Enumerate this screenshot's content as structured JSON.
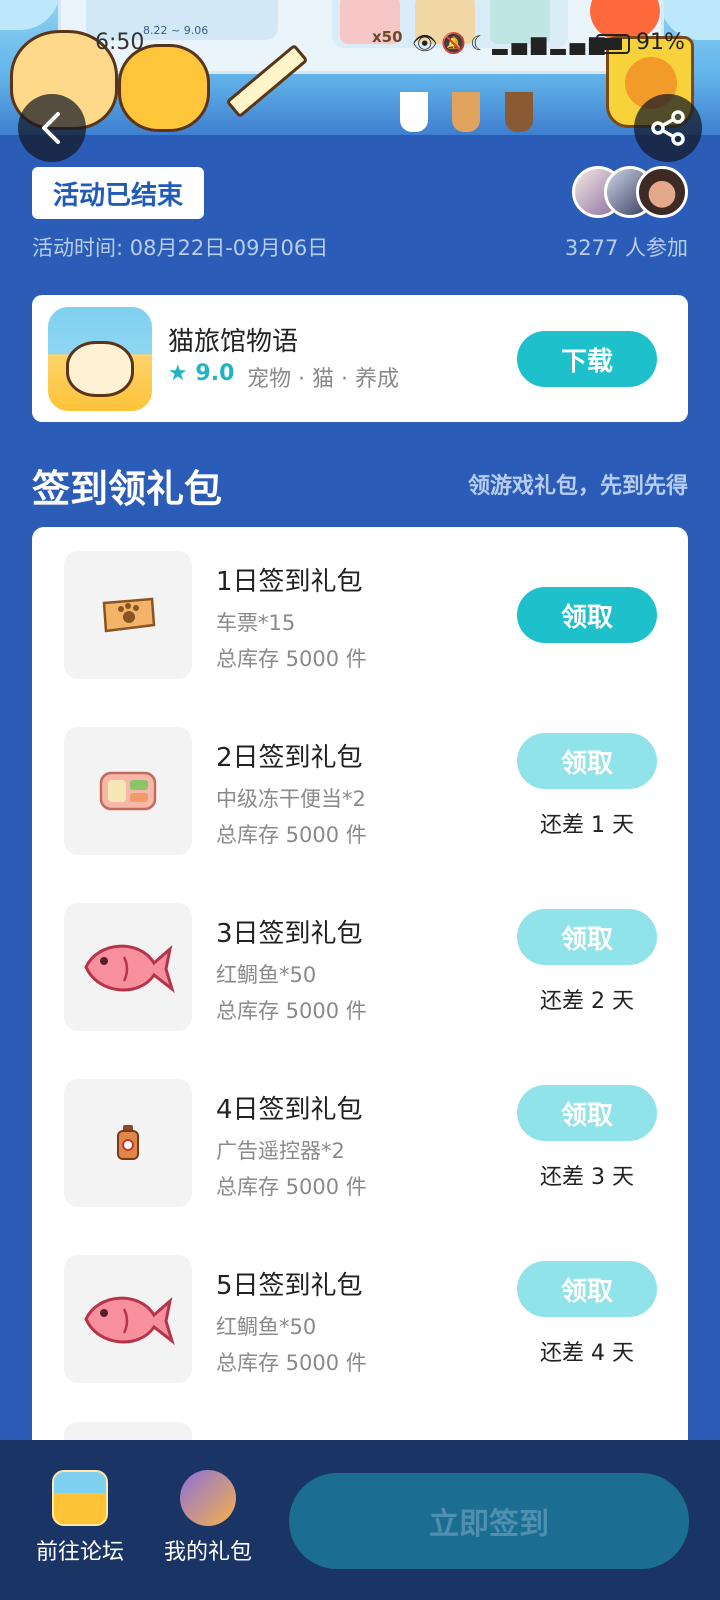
{
  "status_bar": {
    "time": "6:50",
    "battery": "91%"
  },
  "banner": {
    "date_range": "8.22 ~ 9.06",
    "reward_count": "x50"
  },
  "activity": {
    "status_badge": "活动已结束",
    "time": "活动时间: 08月22日-09月06日",
    "participants": "3277 人参加"
  },
  "app": {
    "name": "猫旅馆物语",
    "rating": "9.0",
    "tags": "宠物 · 猫 · 养成",
    "download_label": "下载"
  },
  "section": {
    "title": "签到领礼包",
    "subtitle": "领游戏礼包，先到先得"
  },
  "gifts": [
    {
      "name": "1日签到礼包",
      "item": "车票*15",
      "stock": "总库存 5000 件",
      "button": "领取",
      "remain": ""
    },
    {
      "name": "2日签到礼包",
      "item": "中级冻干便当*2",
      "stock": "总库存 5000 件",
      "button": "领取",
      "remain": "还差 1 天"
    },
    {
      "name": "3日签到礼包",
      "item": "红鲷鱼*50",
      "stock": "总库存 5000 件",
      "button": "领取",
      "remain": "还差 2 天"
    },
    {
      "name": "4日签到礼包",
      "item": "广告遥控器*2",
      "stock": "总库存 5000 件",
      "button": "领取",
      "remain": "还差 3 天"
    },
    {
      "name": "5日签到礼包",
      "item": "红鲷鱼*50",
      "stock": "总库存 5000 件",
      "button": "领取",
      "remain": "还差 4 天"
    }
  ],
  "bottom": {
    "forum_label": "前往论坛",
    "my_gifts_label": "我的礼包",
    "signin_label": "立即签到"
  },
  "colors": {
    "page_bg": "#2a5cb8",
    "accent": "#1ec0cc",
    "accent_disabled": "#8fe3e9",
    "bottom_bar": "#1a3466"
  }
}
